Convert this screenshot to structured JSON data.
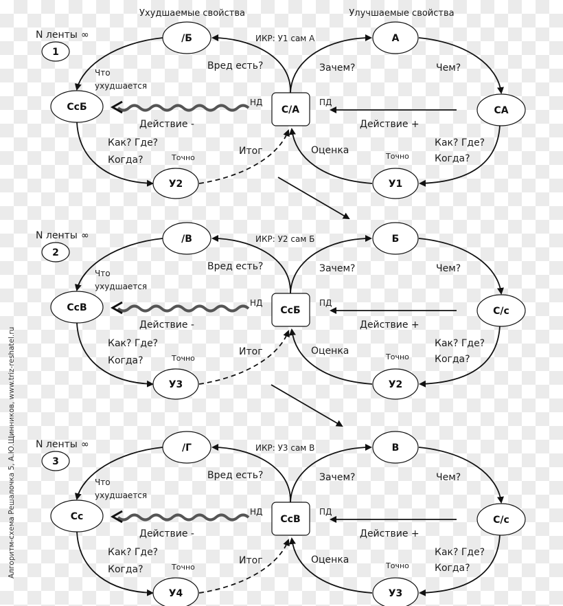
{
  "headers": {
    "worsened_properties": "Ухудшаемые  свойства",
    "improved_properties": "Улучшаемые  свойства"
  },
  "side_caption": "Алгоритм-схема Решалочка 5,  А.Ю.Щинников, www.triz-reshatel.ru",
  "sections": [
    {
      "tape_label": "N ленты",
      "infinity_icon": "∞",
      "number": "1",
      "ikr": "ИКР:  У1 сам А",
      "nodes": {
        "worse_top": "/Б",
        "better_top": "А",
        "worse_left": "СсБ",
        "center_box": "С/А",
        "better_right": "СА",
        "result_left": "У2",
        "result_right": "У1"
      },
      "labels": {
        "harm": "Вред есть?",
        "why": "Зачем?",
        "what_with": "Чем?",
        "what_worsens_1": "Что",
        "what_worsens_2": "ухудшается",
        "nd": "НД",
        "pd": "ПД",
        "action_minus": "Действие  -",
        "action_plus": "Действие +",
        "how_where_left": "Как? Где?",
        "when_left": "Когда?",
        "how_where_right": "Как? Где?",
        "when_right": "Когда?",
        "exact_left": "Точно",
        "exact_right": "Точно",
        "result": "Итог",
        "evaluation": "Оценка"
      }
    },
    {
      "tape_label": "N ленты",
      "infinity_icon": "∞",
      "number": "2",
      "ikr": "ИКР:  У2 сам Б",
      "nodes": {
        "worse_top": "/В",
        "better_top": "Б",
        "worse_left": "СсВ",
        "center_box": "СсБ",
        "better_right": "С/с",
        "result_left": "У3",
        "result_right": "У2"
      },
      "labels": {
        "harm": "Вред есть?",
        "why": "Зачем?",
        "what_with": "Чем?",
        "what_worsens_1": "Что",
        "what_worsens_2": "ухудшается",
        "nd": "НД",
        "pd": "ПД",
        "action_minus": "Действие -",
        "action_plus": "Действие +",
        "how_where_left": "Как? Где?",
        "when_left": "Когда?",
        "how_where_right": "Как? Где?",
        "when_right": "Когда?",
        "exact_left": "Точно",
        "exact_right": "Точно",
        "result": "Итог",
        "evaluation": "Оценка"
      }
    },
    {
      "tape_label": "N ленты",
      "infinity_icon": "∞",
      "number": "3",
      "ikr": "ИКР:  У3 сам В",
      "nodes": {
        "worse_top": "/Г",
        "better_top": "В",
        "worse_left": "Сс",
        "center_box": "СсВ",
        "better_right": "С/с",
        "result_left": "У4",
        "result_right": "У3"
      },
      "labels": {
        "harm": "Вред есть?",
        "why": "Зачем?",
        "what_with": "Чем?",
        "what_worsens_1": "Что",
        "what_worsens_2": "ухудшается",
        "nd": "НД",
        "pd": "ПД",
        "action_minus": "Действие  -",
        "action_plus": "Действие +",
        "how_where_left": "Как? Где?",
        "when_left": "Когда?",
        "how_where_right": "Как? Где?",
        "when_right": "Когда?",
        "exact_left": "Точно",
        "exact_right": "Точно",
        "result": "Итог",
        "evaluation": "Оценка"
      }
    }
  ]
}
